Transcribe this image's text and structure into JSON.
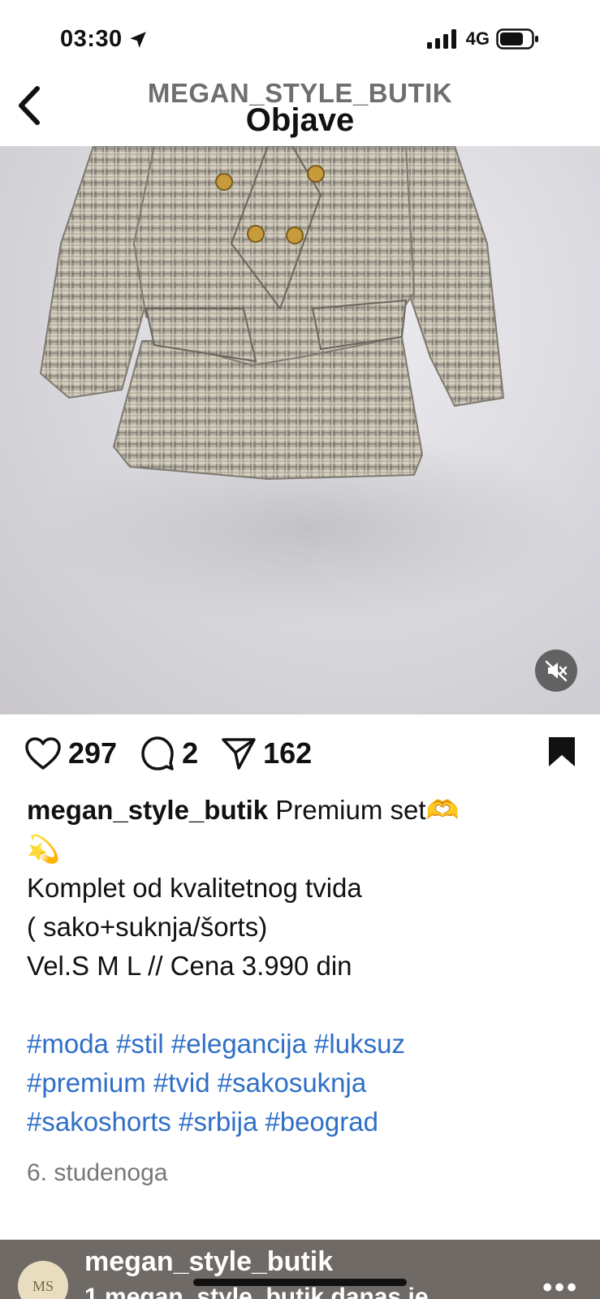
{
  "status_bar": {
    "time": "03:30",
    "network": "4G"
  },
  "header": {
    "account": "MEGAN_STYLE_BUTIK",
    "title": "Objave"
  },
  "post": {
    "likes": "297",
    "comments": "2",
    "shares": "162",
    "username": "megan_style_butik",
    "caption_first": "Premium set🫶",
    "caption_emoji": "💫",
    "caption_lines": [
      "Komplet od kvalitetnog tvida",
      "( sako+suknja/šorts)",
      "Vel.S M L // Cena 3.990 din"
    ],
    "hashtag_lines": [
      "#moda #stil #elegancija #luksuz",
      "#premium #tvid #sakosuknja",
      "#sakoshorts #srbija #beograd"
    ],
    "date": "6. studenoga"
  },
  "next_post": {
    "username": "megan_style_butik",
    "avatar_text": "MS",
    "subtitle": "1 megan_style_butik danas je"
  },
  "colors": {
    "hashtag": "#2f6fc6",
    "bookmark": "#111111",
    "strip_bg": "#6f6a66"
  },
  "icons": [
    "location-arrow-icon",
    "signal-icon",
    "battery-icon",
    "back-chevron-icon",
    "heart-icon",
    "comment-icon",
    "share-icon",
    "bookmark-icon",
    "mute-icon",
    "more-icon"
  ]
}
